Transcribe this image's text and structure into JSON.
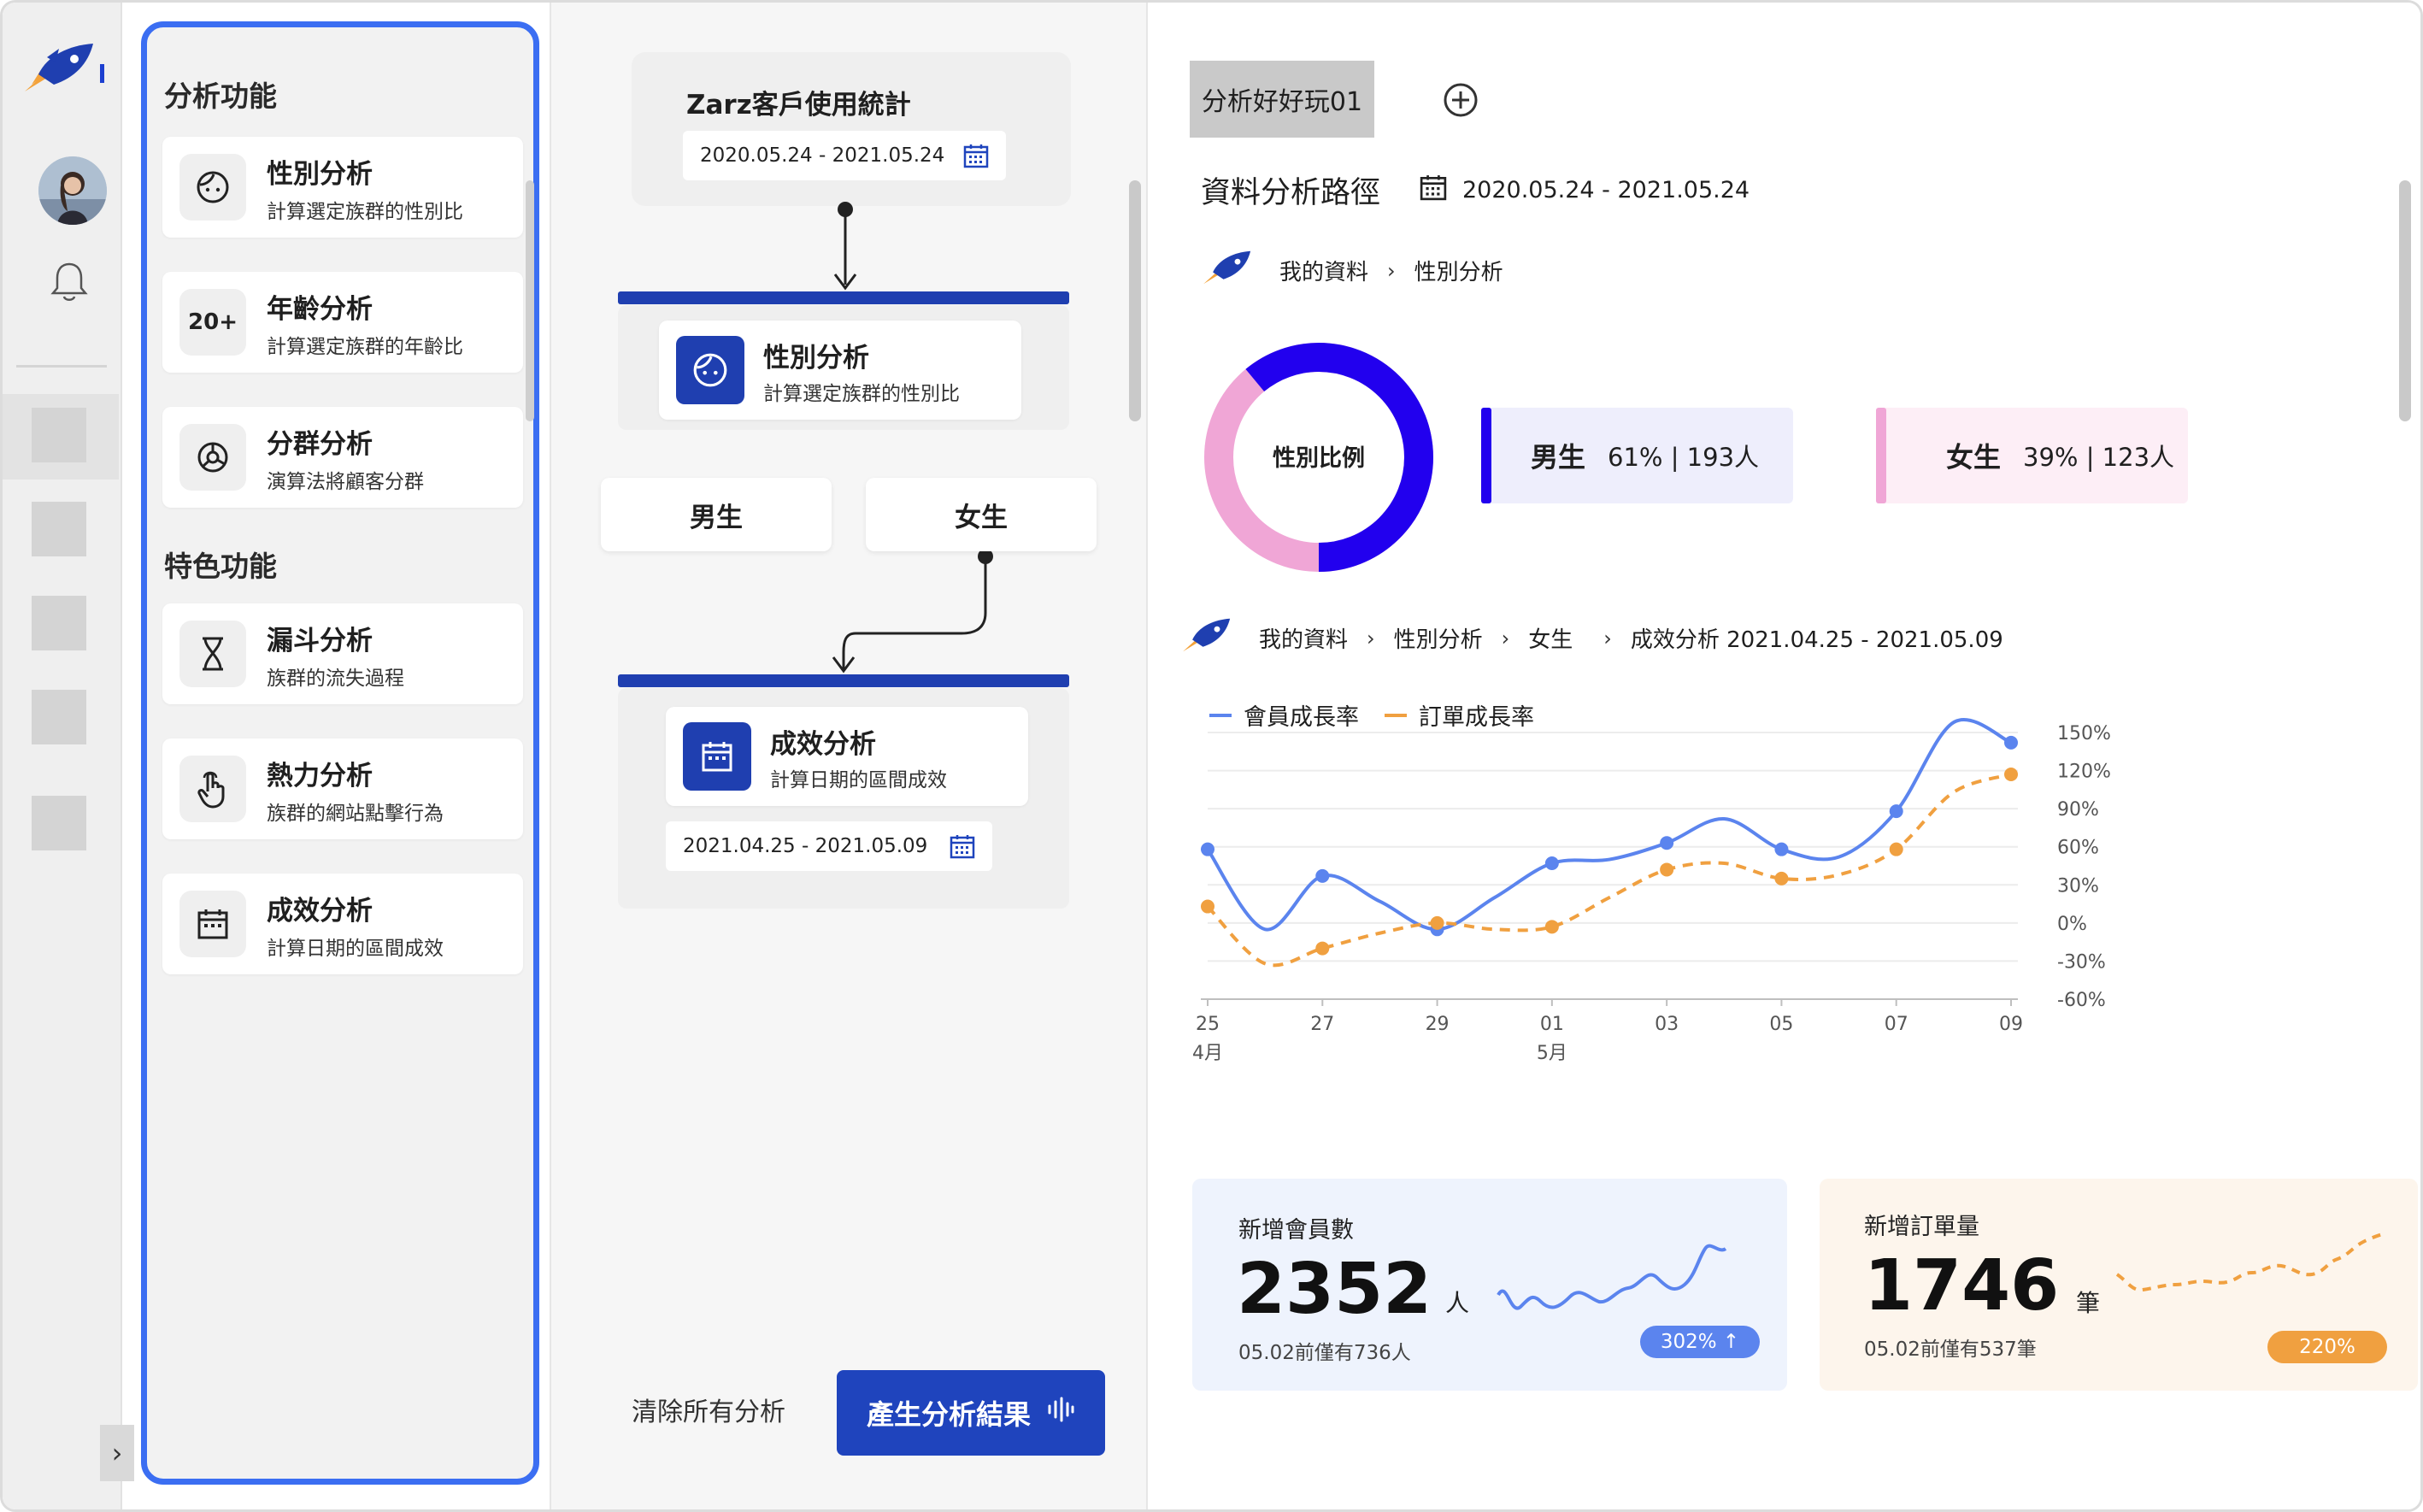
{
  "sidebar": {
    "section_analysis": "分析功能",
    "section_feature": "特色功能",
    "items": [
      {
        "title": "性別分析",
        "desc": "計算選定族群的性別比",
        "icon": "face-icon"
      },
      {
        "title": "年齡分析",
        "desc": "計算選定族群的年齡比",
        "icon": "age-icon",
        "icon_text": "20+"
      },
      {
        "title": "分群分析",
        "desc": "演算法將顧客分群",
        "icon": "pie-segments-icon"
      },
      {
        "title": "漏斗分析",
        "desc": "族群的流失過程",
        "icon": "hourglass-icon"
      },
      {
        "title": "熱力分析",
        "desc": "族群的網站點擊行為",
        "icon": "pointer-hand-icon"
      },
      {
        "title": "成效分析",
        "desc": "計算日期的區間成效",
        "icon": "calendar-icon"
      }
    ]
  },
  "flow": {
    "source_title": "Zarz客戶使用統計",
    "source_date": "2020.05.24 - 2021.05.24",
    "node1": {
      "title": "性別分析",
      "desc": "計算選定族群的性別比"
    },
    "branch_male": "男生",
    "branch_female": "女生",
    "node2": {
      "title": "成效分析",
      "desc": "計算日期的區間成效",
      "date": "2021.04.25 - 2021.05.09"
    },
    "clear_label": "清除所有分析",
    "generate_label": "產生分析結果"
  },
  "result": {
    "tab_label": "分析好好玩01",
    "path_title": "資料分析路徑",
    "path_date": "2020.05.24 - 2021.05.24",
    "crumb1": [
      "我的資料",
      "性別分析"
    ],
    "donut_label": "性別比例",
    "male": {
      "label": "男生",
      "value": "61% | 193人",
      "share": 0.61
    },
    "female": {
      "label": "女生",
      "value": "39% | 123人",
      "share": 0.39
    },
    "crumb2": [
      "我的資料",
      "性別分析",
      "女生",
      "成效分析 2021.04.25 - 2021.05.09"
    ],
    "kpi_members": {
      "label": "新增會員數",
      "value": "2352",
      "unit": "人",
      "sub": "05.02前僅有736人",
      "badge": "302% ↑"
    },
    "kpi_orders": {
      "label": "新增訂單量",
      "value": "1746",
      "unit": "筆",
      "sub": "05.02前僅有537筆",
      "badge": "220%"
    }
  },
  "colors": {
    "brand": "#1f44bd",
    "male": "#2200ee",
    "female": "#f0a6d6",
    "member_line": "#5b84ee",
    "order_line": "#f0a040"
  },
  "chart_data": {
    "type": "line",
    "x": [
      "25",
      "26",
      "27",
      "28",
      "29",
      "30",
      "01",
      "02",
      "03",
      "04",
      "05",
      "06",
      "07",
      "08",
      "09"
    ],
    "x_ticks": [
      "25",
      "27",
      "29",
      "01",
      "03",
      "05",
      "07",
      "09"
    ],
    "x_month_labels": [
      {
        "at": "25",
        "label": "4月"
      },
      {
        "at": "01",
        "label": "5月"
      }
    ],
    "y_ticks": [
      "150%",
      "120%",
      "90%",
      "60%",
      "30%",
      "0%",
      "-30%",
      "-60%"
    ],
    "ylim": [
      -60,
      150
    ],
    "grid": true,
    "legend_position": "top-left",
    "series": [
      {
        "name": "會員成長率",
        "color": "#5b84ee",
        "values": [
          58,
          -5,
          37,
          17,
          -5,
          20,
          47,
          50,
          63,
          82,
          58,
          52,
          88,
          158,
          142
        ]
      },
      {
        "name": "訂單成長率",
        "color": "#f0a040",
        "values": [
          13,
          -32,
          -20,
          -8,
          0,
          -5,
          -3,
          20,
          42,
          47,
          35,
          38,
          58,
          103,
          117
        ]
      }
    ]
  }
}
